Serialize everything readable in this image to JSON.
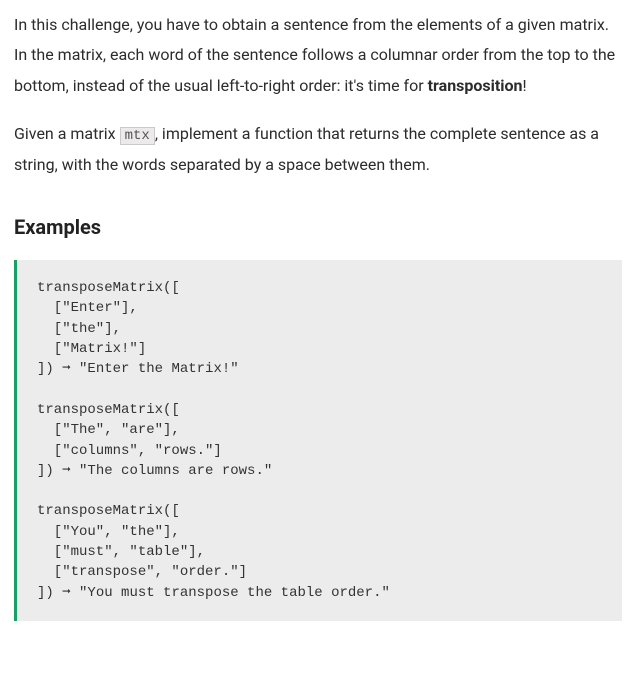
{
  "intro": {
    "p1_part1": "In this challenge, you have to obtain a sentence from the elements of a given matrix. In the matrix, each word of the sentence follows a columnar order from the top to the bottom, instead of the usual left-to-right order: it's time for ",
    "p1_bold": "transposition",
    "p1_part2": "!",
    "p2_part1": "Given a matrix ",
    "p2_code": "mtx",
    "p2_part2": ", implement a function that returns the complete sentence as a string, with the words separated by a space between them."
  },
  "examples_heading": "Examples",
  "code_example": "transposeMatrix([\n  [\"Enter\"],\n  [\"the\"],\n  [\"Matrix!\"]\n]) ➞ \"Enter the Matrix!\"\n\ntransposeMatrix([\n  [\"The\", \"are\"],\n  [\"columns\", \"rows.\"]\n]) ➞ \"The columns are rows.\"\n\ntransposeMatrix([\n  [\"You\", \"the\"],\n  [\"must\", \"table\"],\n  [\"transpose\", \"order.\"]\n]) ➞ \"You must transpose the table order.\""
}
